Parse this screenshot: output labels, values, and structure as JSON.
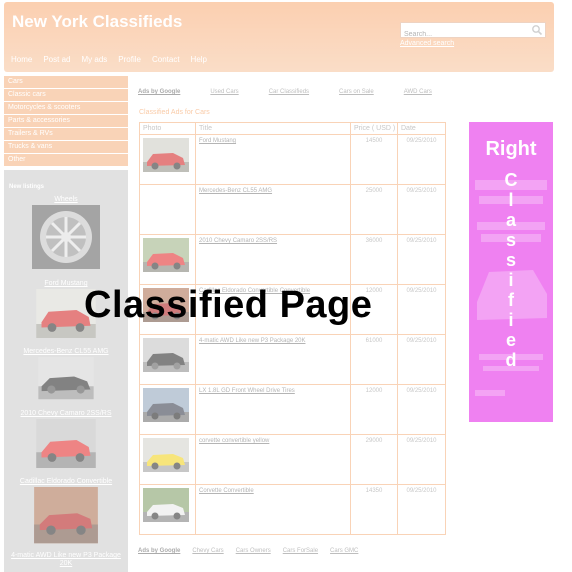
{
  "header": {
    "title": "New York Classifieds",
    "search_placeholder": "Search...",
    "advanced_search": "Advanced search",
    "nav": [
      "Home",
      "Post ad",
      "My ads",
      "Profile",
      "Contact",
      "Help"
    ]
  },
  "categories": [
    "Cars",
    "Classic cars",
    "Motorcycles & scooters",
    "Parts & accessories",
    "Trailers & RVs",
    "Trucks & vans",
    "Other"
  ],
  "new_listings": {
    "title": "New listings",
    "items": [
      "Wheels",
      "Ford Mustang",
      "Mercedes-Benz CL55 AMG",
      "2010 Chevy Camaro 2SS/RS",
      "Cadillac Eldorado Convertible",
      "4-matic AWD Like new P3 Package 20K"
    ]
  },
  "ads_top": [
    "Ads by Google",
    "Used Cars",
    "Car Classifieds",
    "Cars on Sale",
    "AWD Cars"
  ],
  "ads_bottom": [
    "Ads by Google",
    "Chevy Cars",
    "Cars Owners",
    "Cars ForSale",
    "Cars GMC"
  ],
  "listing": {
    "title": "Classified Ads for Cars",
    "columns": [
      "Photo",
      "Title",
      "Price ( USD )",
      "Date"
    ],
    "rows": [
      {
        "title": "Ford Mustang",
        "price": "14500",
        "date": "09/25/2010"
      },
      {
        "title": "Mercedes-Benz CL55 AMG",
        "price": "25000",
        "date": "09/25/2010"
      },
      {
        "title": "2010 Chevy Camaro 2SS/RS",
        "price": "36000",
        "date": "09/25/2010"
      },
      {
        "title": "Cadillac Eldorado Convertible Convertible",
        "price": "12000",
        "date": "09/25/2010"
      },
      {
        "title": "4-matic AWD Like new P3 Package 20K",
        "price": "61000",
        "date": "09/25/2010"
      },
      {
        "title": "LX 1.8L GD Front Wheel Drive Tires",
        "price": "12000",
        "date": "09/25/2010"
      },
      {
        "title": "corvette convertible yellow",
        "price": "29000",
        "date": "09/25/2010"
      },
      {
        "title": "Corvette Convertible",
        "price": "14350",
        "date": "09/25/2010"
      }
    ]
  },
  "right_ad": {
    "word": "Right",
    "letters": [
      "C",
      "l",
      "a",
      "s",
      "s",
      "i",
      "f",
      "i",
      "e",
      "d"
    ]
  },
  "overlay_text": "Classified Page",
  "colors": {
    "accent": "#f5a060",
    "right_ad": "#e21be6"
  }
}
